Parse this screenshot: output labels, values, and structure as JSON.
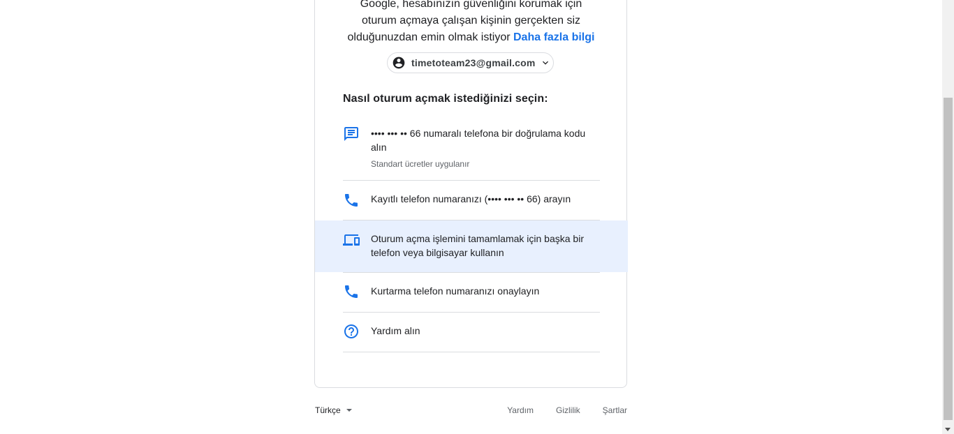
{
  "intro": {
    "line1": "Google, hesabınızın güvenliğini korumak için",
    "line2": "oturum açmaya çalışan kişinin gerçekten siz",
    "line3": "olduğunuzdan emin olmak istiyor",
    "learn_more": "Daha fazla bilgi"
  },
  "account": {
    "email": "timetoteam23@gmail.com"
  },
  "heading": "Nasıl oturum açmak istediğinizi seçin:",
  "options": [
    {
      "icon": "sms-icon",
      "label": "•••• ••• •• 66 numaralı telefona bir doğrulama kodu alın",
      "sub": "Standart ücretler uygulanır"
    },
    {
      "icon": "phone-icon",
      "label": "Kayıtlı telefon numaranızı (•••• ••• •• 66) arayın"
    },
    {
      "icon": "devices-icon",
      "label": "Oturum açma işlemini tamamlamak için başka bir telefon veya bilgisayar kullanın"
    },
    {
      "icon": "phone-icon",
      "label": "Kurtarma telefon numaranızı onaylayın"
    },
    {
      "icon": "help-icon",
      "label": "Yardım alın"
    }
  ],
  "footer": {
    "language": "Türkçe",
    "links": [
      "Yardım",
      "Gizlilik",
      "Şartlar"
    ]
  },
  "colors": {
    "accent": "#1a73e8",
    "highlight": "#e8f0fe",
    "border": "#dadce0"
  }
}
